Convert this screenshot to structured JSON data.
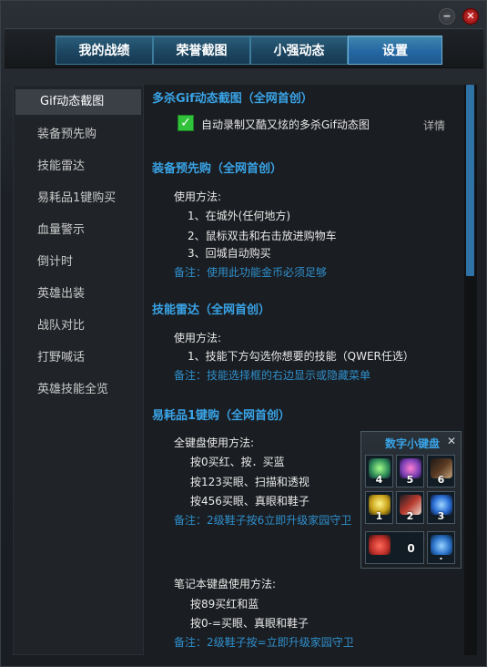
{
  "window": {
    "minimize_icon": "minimize-icon",
    "close_icon": "close-icon",
    "minimize_symbol": "−",
    "close_symbol": "✕"
  },
  "tabs": [
    {
      "label": "我的战绩",
      "active": false
    },
    {
      "label": "荣誉截图",
      "active": false
    },
    {
      "label": "小强动态",
      "active": false
    },
    {
      "label": "设置",
      "active": true
    }
  ],
  "sidebar": {
    "items": [
      {
        "label": "Gif动态截图",
        "active": true
      },
      {
        "label": "装备预先购",
        "active": false
      },
      {
        "label": "技能雷达",
        "active": false
      },
      {
        "label": "易耗品1键购买",
        "active": false
      },
      {
        "label": "血量警示",
        "active": false
      },
      {
        "label": "倒计时",
        "active": false
      },
      {
        "label": "英雄出装",
        "active": false
      },
      {
        "label": "战队对比",
        "active": false
      },
      {
        "label": "打野喊话",
        "active": false
      },
      {
        "label": "英雄技能全览",
        "active": false
      }
    ]
  },
  "sections": {
    "gif": {
      "title": "多杀Gif动态截图（全网首创）",
      "checkbox_label": "自动录制又酷又炫的多杀Gif动态图",
      "checkbox_checked": true,
      "detail_link": "详情"
    },
    "prebuy": {
      "title": "装备预先购（全网首创）",
      "usage": "使用方法:",
      "steps": [
        "1、在城外(任何地方)",
        "2、鼠标双击和右击放进购物车",
        "3、回城自动购买"
      ],
      "note": "备注：使用此功能金币必须足够"
    },
    "radar": {
      "title": "技能雷达（全网首创）",
      "usage": "使用方法:",
      "steps": [
        "1、技能下方勾选你想要的技能（QWER任选）"
      ],
      "note": "备注：技能选择框的右边显示或隐藏菜单"
    },
    "consumable": {
      "title": "易耗品1键购（全网首创）",
      "full_kb_usage": "全键盘使用方法:",
      "full_kb_steps": [
        "按0买红、按．买蓝",
        "按123买眼、扫描和透视",
        "按456买眼、真眼和鞋子"
      ],
      "full_kb_note": "备注：2级鞋子按6立即升级家园守卫",
      "laptop_usage": "笔记本键盘使用方法:",
      "laptop_steps": [
        "按89买红和蓝",
        "按0-=买眼、真眼和鞋子"
      ],
      "laptop_note": "备注：2级鞋子按=立即升级家园守卫"
    }
  },
  "numpad": {
    "title": "数字小键盘",
    "close_symbol": "✕",
    "keys": [
      {
        "label": "4",
        "icon": "ward-icon",
        "color": "#2e8b57"
      },
      {
        "label": "5",
        "icon": "vision-ward-icon",
        "color": "#7a3fb5"
      },
      {
        "label": "6",
        "icon": "boots-icon",
        "color": "#5a3a22"
      },
      {
        "label": "1",
        "icon": "yellow-trinket-icon",
        "color": "#c9a21a"
      },
      {
        "label": "2",
        "icon": "sweeper-icon",
        "color": "#b83a2e"
      },
      {
        "label": "3",
        "icon": "oracle-icon",
        "color": "#2a6fd6"
      },
      {
        "label": "0",
        "icon": "health-potion-icon",
        "color": "#c0302a"
      },
      {
        "label": ".",
        "icon": "mana-potion-icon",
        "color": "#2a72c9"
      }
    ]
  }
}
